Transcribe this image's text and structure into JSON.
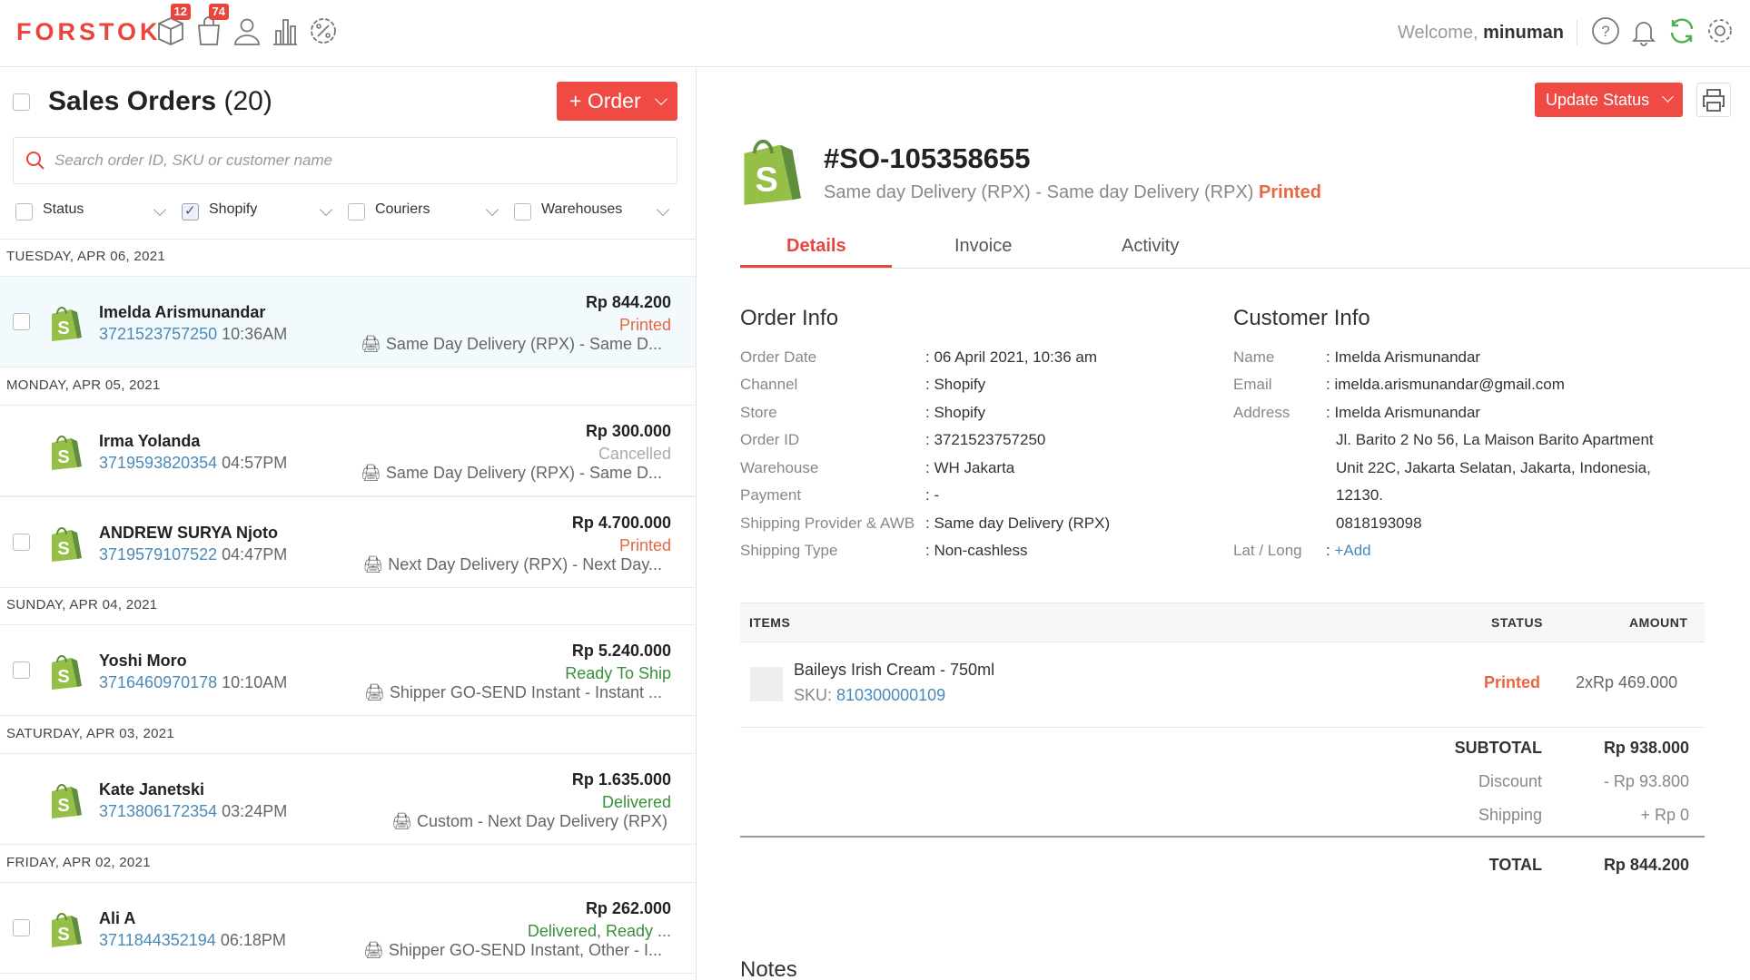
{
  "brand": "FORSTOK",
  "nav": {
    "badges": {
      "products": "12",
      "orders": "74"
    },
    "welcome_prefix": "Welcome,",
    "username": "minuman"
  },
  "list": {
    "title": "Sales Orders",
    "count": "(20)",
    "order_button": "+ Order",
    "search_placeholder": "Search order ID, SKU or customer name",
    "filters": [
      {
        "label": "Status",
        "checked": false
      },
      {
        "label": "Shopify",
        "checked": true
      },
      {
        "label": "Couriers",
        "checked": false
      },
      {
        "label": "Warehouses",
        "checked": false
      }
    ],
    "dates": [
      "TUESDAY, APR 06, 2021",
      "MONDAY, APR 05, 2021",
      "SUNDAY, APR 04, 2021",
      "SATURDAY, APR 03, 2021",
      "FRIDAY, APR 02, 2021"
    ],
    "orders": [
      {
        "name": "Imelda Arismunandar",
        "id": "3721523757250",
        "time": "10:36AM",
        "amount": "Rp 844.200",
        "status": "Printed",
        "status_color": "#e8673f",
        "shipping": "Same Day Delivery (RPX) - Same D..."
      },
      {
        "name": "Irma Yolanda",
        "id": "3719593820354",
        "time": "04:57PM",
        "amount": "Rp 300.000",
        "status": "Cancelled",
        "status_color": "#aaaaaa",
        "shipping": "Same Day Delivery (RPX) - Same D..."
      },
      {
        "name": "ANDREW SURYA Njoto",
        "id": "3719579107522",
        "time": "04:47PM",
        "amount": "Rp 4.700.000",
        "status": "Printed",
        "status_color": "#e8673f",
        "shipping": "Next Day Delivery (RPX) - Next Day..."
      },
      {
        "name": "Yoshi Moro",
        "id": "3716460970178",
        "time": "10:10AM",
        "amount": "Rp 5.240.000",
        "status": "Ready To Ship",
        "status_color": "#3a8f3a",
        "shipping": "Shipper GO-SEND Instant - Instant ..."
      },
      {
        "name": "Kate Janetski",
        "id": "3713806172354",
        "time": "03:24PM",
        "amount": "Rp 1.635.000",
        "status": "Delivered",
        "status_color": "#3a8f3a",
        "shipping": "Custom - Next Day Delivery (RPX)"
      },
      {
        "name": "Ali A",
        "id": "3711844352194",
        "time": "06:18PM",
        "amount": "Rp 262.000",
        "status": "Delivered, Ready ...",
        "status_color": "#3a8f3a",
        "shipping": "Shipper GO-SEND Instant, Other - I..."
      }
    ]
  },
  "detail": {
    "update_status": "Update Status",
    "order_number": "#SO-105358655",
    "subline": "Same day Delivery (RPX) - Same day Delivery (RPX)",
    "subline_status": "Printed",
    "tabs": [
      "Details",
      "Invoice",
      "Activity"
    ],
    "order_info": {
      "title": "Order Info",
      "rows": [
        {
          "label": "Order Date",
          "value": "06 April 2021, 10:36 am"
        },
        {
          "label": "Channel",
          "value": "Shopify"
        },
        {
          "label": "Store",
          "value": "Shopify"
        },
        {
          "label": "Order ID",
          "value": "3721523757250"
        },
        {
          "label": "Warehouse",
          "value": "WH Jakarta"
        },
        {
          "label": "Payment",
          "value": "-"
        },
        {
          "label": "Shipping Provider & AWB",
          "value": "Same day Delivery (RPX)"
        },
        {
          "label": "Shipping Type",
          "value": "Non-cashless"
        }
      ]
    },
    "customer_info": {
      "title": "Customer Info",
      "name_label": "Name",
      "name": "Imelda Arismunandar",
      "email_label": "Email",
      "email": "imelda.arismunandar@gmail.com",
      "address_label": "Address",
      "address_lines": [
        "Imelda Arismunandar",
        "Jl. Barito 2 No 56, La Maison Barito Apartment",
        "Unit 22C, Jakarta Selatan, Jakarta, Indonesia,",
        "12130.",
        "0818193098"
      ],
      "latlong_label": "Lat / Long",
      "latlong_action": "+Add"
    },
    "items_table": {
      "headers": {
        "items": "ITEMS",
        "status": "STATUS",
        "amount": "AMOUNT"
      },
      "item": {
        "name": "Baileys Irish Cream - 750ml",
        "sku_label": "SKU:",
        "sku": "810300000109",
        "status": "Printed",
        "amount": "2xRp 469.000"
      }
    },
    "totals": {
      "subtotal_label": "SUBTOTAL",
      "subtotal": "Rp 938.000",
      "discount_label": "Discount",
      "discount": "- Rp 93.800",
      "shipping_label": "Shipping",
      "shipping": "+ Rp 0",
      "total_label": "TOTAL",
      "total": "Rp 844.200"
    },
    "notes_title": "Notes"
  }
}
